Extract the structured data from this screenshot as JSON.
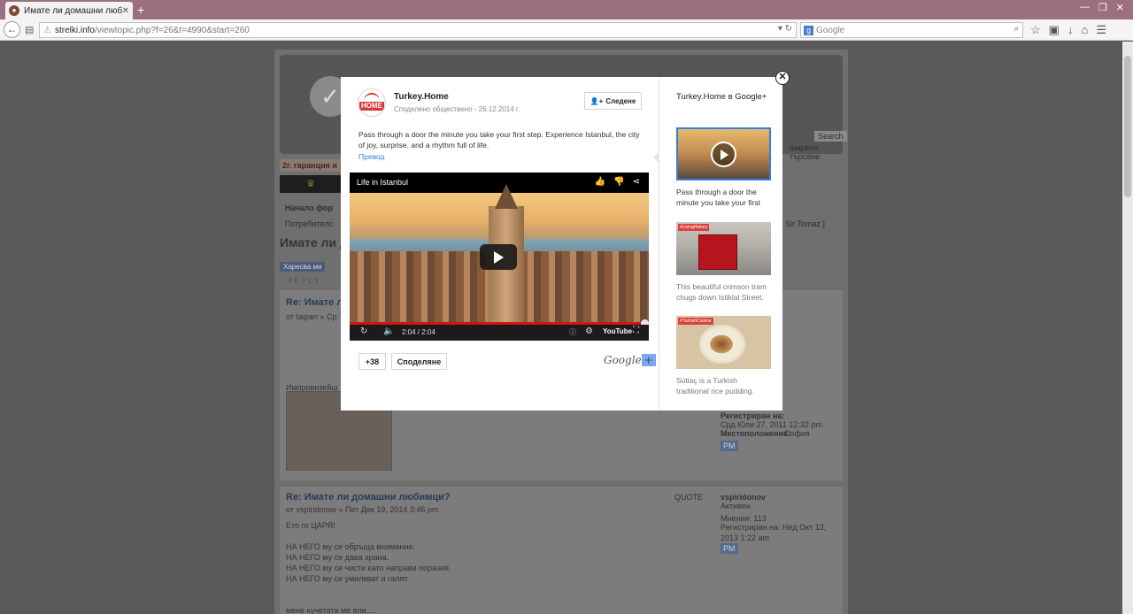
{
  "browser": {
    "tab_title": "Имате ли домашни люби...",
    "url_host": "strelki.info",
    "url_path": "/viewtopic.php?f=26&t=4990&start=260",
    "search_placeholder": "Google"
  },
  "forum": {
    "topic_title": "Имате ли д",
    "like_label": "Харесва ми",
    "reply_label": "REPLY",
    "search_label": "Search",
    "search_hint": "ширено търсене",
    "promo": "2г. гаранция и",
    "home_link": "Начало фор",
    "users_link": "Потребителс",
    "author_tag": "es [ Sir Tomaz ]",
    "post1_title": "Re: Имате л",
    "post1_meta": "от taipan » Ср",
    "post1_text": "Импровизейш",
    "post1_reg_label": "Регистриран на:",
    "post1_reg_value": "Срд Юли 27, 2011 12:32 pm",
    "post1_loc_label": "Местоположение:",
    "post1_loc_value": "София",
    "post2_title": "Re: Имате ли домашни любимци?",
    "post2_meta": "от vspiridonov » Пет Дек 19, 2014 3:46 pm",
    "post2_line1": "Ето го ЦАРЯ!",
    "post2_line2": "НА НЕГО му се обръща внимание.",
    "post2_line3": "НА НЕГО му се дава храна.",
    "post2_line4": "НА НЕГО му се чисти като направи поразия.",
    "post2_line5": "НА НЕГО му се умилкват и галят.",
    "post2_line6": "мене кучетата ме яли.....",
    "post2_author": "vspiridonov",
    "post2_rank": "Активен",
    "post2_msgs": "Мнения: 113",
    "post2_reg": "Регистриран на: Нед Окт 13, 2013 1:22 am",
    "quote_label": "QUOTE",
    "pm_label": "PM"
  },
  "modal": {
    "author": "Turkey.Home",
    "avatar_text": "HOME",
    "meta": "Споделено обществено  -  26.12.2014 г.",
    "follow_label": "Следене",
    "post_text": "Pass through a door the minute you take your first step. Experience Istanbul, the city of joy, surprise, and a rhythm full of life.",
    "translate_label": "Превод",
    "video_title": "Life in Istanbul",
    "video_time": "2:04 / 2:04",
    "video_progress": 1.0,
    "youtube_label": "YouTube",
    "plus_count": "+38",
    "share_label": "Споделяне",
    "gplus_word": "Google",
    "gplus_plus": "+",
    "side_title": "Turkey.Home в Google+",
    "cards": [
      {
        "caption": "Pass through a door the minute you take your first step.",
        "tag": ""
      },
      {
        "caption": "This beautiful crimson tram chugs down Istiklal Street.",
        "tag": "#LivingHistory"
      },
      {
        "caption": "Sütlaç is a Turkish traditional rice pudding.",
        "tag": "#TurkishCuisine"
      }
    ]
  }
}
